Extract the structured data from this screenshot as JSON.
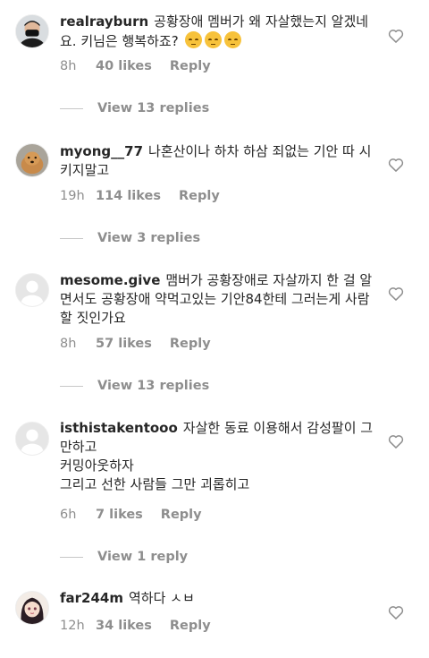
{
  "comments": [
    {
      "username": "realrayburn",
      "text": "공황장애 멤버가 왜 자살했는지 알겠네요. 키님은 행복하죠?",
      "emojis": [
        "upside-down-face-emoji",
        "upside-down-face-emoji",
        "upside-down-face-emoji"
      ],
      "time": "8h",
      "likes": "40 likes",
      "reply_label": "Reply",
      "view_replies": "View 13 replies",
      "avatar": "person-dark-mask"
    },
    {
      "username": "myong__77",
      "text": "나혼산이나 하차 하삼 죄없는 기안 따 시키지말고",
      "time": "19h",
      "likes": "114 likes",
      "reply_label": "Reply",
      "view_replies": "View 3 replies",
      "avatar": "dog-photo"
    },
    {
      "username": "mesome.give",
      "text": "맴버가 공황장애로 자살까지 한 걸 알면서도 공황장애 약먹고있는 기안84한테 그러는게 사람 할 짓인가요",
      "time": "8h",
      "likes": "57 likes",
      "reply_label": "Reply",
      "view_replies": "View 13 replies",
      "avatar": "default-avatar"
    },
    {
      "username": "isthistakentooo",
      "text": "자살한 동료 이용해서 감성팔이 그만하고\n커밍아웃하자\n그리고 선한 사람들 그만 괴롭히고",
      "time": "6h",
      "likes": "7 likes",
      "reply_label": "Reply",
      "view_replies": "View 1 reply",
      "avatar": "default-avatar"
    },
    {
      "username": "far244m",
      "text": "역하다 ㅅㅂ",
      "time": "12h",
      "likes": "34 likes",
      "reply_label": "Reply",
      "avatar": "anime-girl"
    }
  ],
  "colors": {
    "text": "#262626",
    "secondary": "#8e8e8e",
    "divider": "#c7c7c7"
  },
  "icons": {
    "like": "heart-outline-icon"
  }
}
